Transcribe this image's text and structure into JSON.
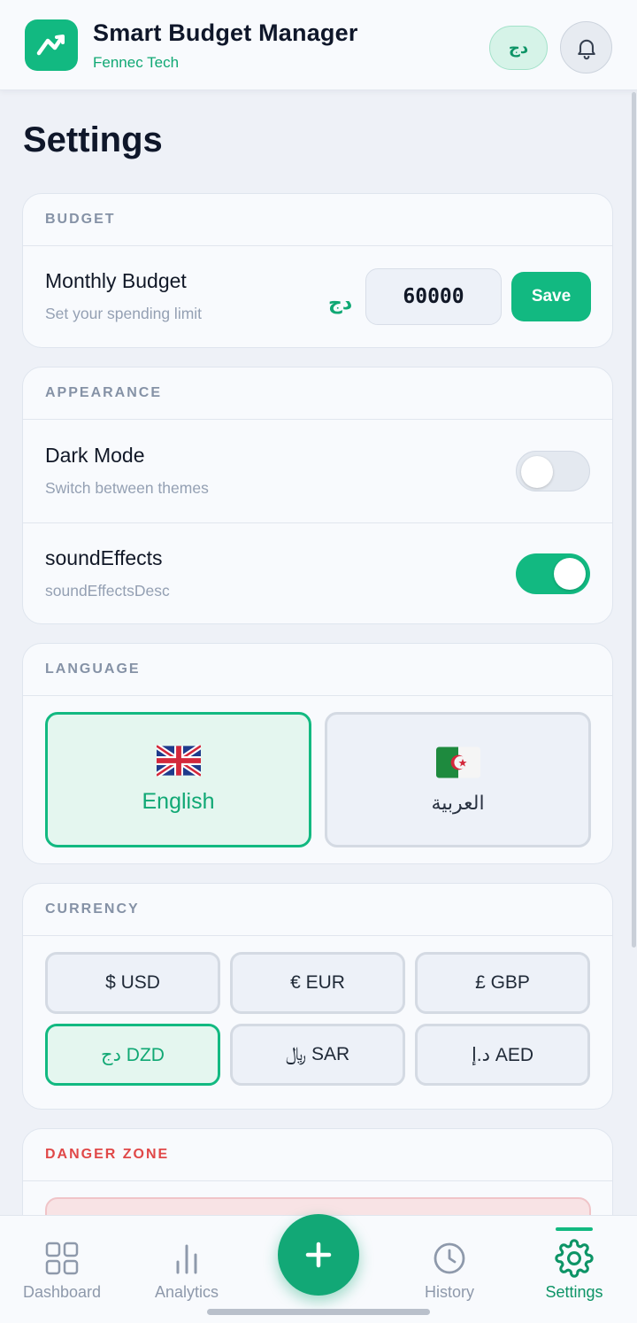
{
  "header": {
    "title": "Smart Budget Manager",
    "subtitle": "Fennec Tech",
    "currency_symbol": "دج",
    "logo_icon": "chart-trend-icon",
    "bell_icon": "bell-icon"
  },
  "page": {
    "title": "Settings"
  },
  "budget": {
    "section": "BUDGET",
    "label": "Monthly Budget",
    "desc": "Set your spending limit",
    "currency_symbol": "دج",
    "value": "60000",
    "save_label": "Save"
  },
  "appearance": {
    "section": "APPEARANCE",
    "dark_mode": {
      "label": "Dark Mode",
      "desc": "Switch between themes",
      "enabled": false
    },
    "sound": {
      "label": "soundEffects",
      "desc": "soundEffectsDesc",
      "enabled": true
    }
  },
  "language": {
    "section": "LANGUAGE",
    "options": [
      {
        "label": "English",
        "flag": "uk-flag-icon",
        "selected": true
      },
      {
        "label": "العربية",
        "flag": "algeria-flag-icon",
        "selected": false
      }
    ]
  },
  "currency": {
    "section": "CURRENCY",
    "options": [
      {
        "label": "$ USD",
        "selected": false
      },
      {
        "label": "€ EUR",
        "selected": false
      },
      {
        "label": "£ GBP",
        "selected": false
      },
      {
        "label": "دج DZD",
        "selected": true
      },
      {
        "label": "﷼ SAR",
        "selected": false
      },
      {
        "label": "د.إ AED",
        "selected": false
      }
    ]
  },
  "danger": {
    "section": "DANGER ZONE"
  },
  "nav": {
    "items": [
      {
        "label": "Dashboard",
        "icon": "grid-icon",
        "active": false
      },
      {
        "label": "Analytics",
        "icon": "bar-chart-icon",
        "active": false
      },
      {
        "label": "History",
        "icon": "clock-icon",
        "active": false
      },
      {
        "label": "Settings",
        "icon": "gear-icon",
        "active": true
      }
    ],
    "fab_icon": "plus-icon"
  },
  "colors": {
    "accent": "#12b981",
    "danger": "#e04848",
    "background": "#eef1f7"
  }
}
